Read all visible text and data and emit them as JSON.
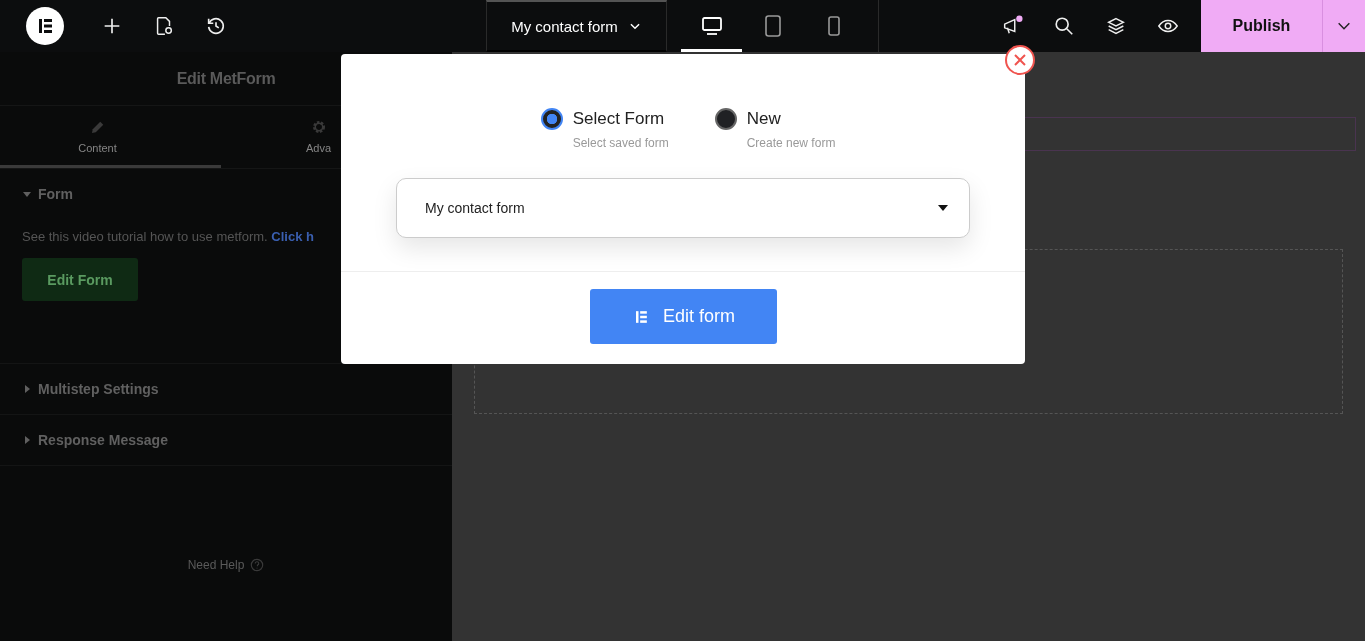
{
  "top_bar": {
    "document_title": "My contact form",
    "devices": [
      {
        "kind": "desktop",
        "selected": true
      },
      {
        "kind": "tablet",
        "selected": false
      },
      {
        "kind": "mobile",
        "selected": false
      }
    ],
    "notification_dot": true,
    "publish_label": "Publish"
  },
  "panel": {
    "title": "Edit MetForm",
    "tabs": [
      {
        "label": "Content",
        "selected": true
      },
      {
        "label": "Adva",
        "selected": false
      }
    ],
    "sections": [
      {
        "title": "Form",
        "expanded": true,
        "description": "See this video tutorial how to use metform.",
        "link": "Click h",
        "button": "Edit Form"
      },
      {
        "title": "Multistep Settings",
        "expanded": false
      },
      {
        "title": "Response Message",
        "expanded": false
      }
    ],
    "help": "Need Help"
  },
  "modal": {
    "options": [
      {
        "label": "Select Form",
        "hint": "Select saved form",
        "selected": true
      },
      {
        "label": "New",
        "hint": "Create new form",
        "selected": false
      }
    ],
    "form_select": {
      "value": "My contact form"
    },
    "button": "Edit form"
  }
}
